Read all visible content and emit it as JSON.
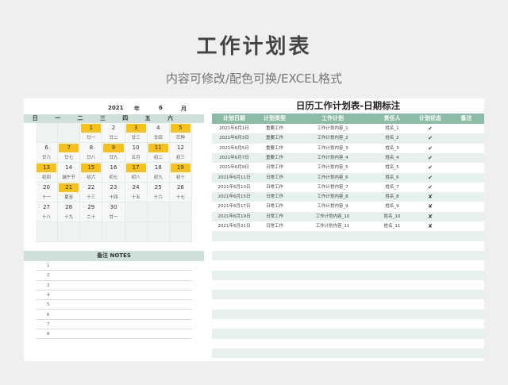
{
  "page": {
    "title": "工作计划表",
    "subtitle": "内容可修改/配色可换/EXCEL格式"
  },
  "calendar": {
    "year": "2021",
    "year_label": "年",
    "month": "6",
    "month_label": "月",
    "weekdays": [
      "日",
      "一",
      "二",
      "三",
      "四",
      "五",
      "六"
    ],
    "highlight_color": "#f7c11c",
    "cells": [
      {
        "day": "",
        "lunar": "",
        "hl": false
      },
      {
        "day": "",
        "lunar": "",
        "hl": false
      },
      {
        "day": "1",
        "lunar": "廿一",
        "hl": true
      },
      {
        "day": "2",
        "lunar": "廿二",
        "hl": false
      },
      {
        "day": "3",
        "lunar": "廿三",
        "hl": true
      },
      {
        "day": "4",
        "lunar": "廿四",
        "hl": false
      },
      {
        "day": "5",
        "lunar": "芒种",
        "hl": true
      },
      {
        "day": "6",
        "lunar": "廿六",
        "hl": false
      },
      {
        "day": "7",
        "lunar": "廿七",
        "hl": true
      },
      {
        "day": "8",
        "lunar": "廿八",
        "hl": false
      },
      {
        "day": "9",
        "lunar": "廿九",
        "hl": true
      },
      {
        "day": "10",
        "lunar": "五月",
        "hl": false
      },
      {
        "day": "11",
        "lunar": "初二",
        "hl": true
      },
      {
        "day": "12",
        "lunar": "初三",
        "hl": false
      },
      {
        "day": "13",
        "lunar": "初四",
        "hl": true
      },
      {
        "day": "14",
        "lunar": "端午节",
        "hl": false
      },
      {
        "day": "15",
        "lunar": "初六",
        "hl": true
      },
      {
        "day": "16",
        "lunar": "初七",
        "hl": false
      },
      {
        "day": "17",
        "lunar": "初八",
        "hl": true
      },
      {
        "day": "18",
        "lunar": "初九",
        "hl": false
      },
      {
        "day": "19",
        "lunar": "初十",
        "hl": true
      },
      {
        "day": "20",
        "lunar": "十一",
        "hl": false
      },
      {
        "day": "21",
        "lunar": "夏至",
        "hl": true
      },
      {
        "day": "22",
        "lunar": "十三",
        "hl": false
      },
      {
        "day": "23",
        "lunar": "十四",
        "hl": false
      },
      {
        "day": "24",
        "lunar": "十五",
        "hl": false
      },
      {
        "day": "25",
        "lunar": "十六",
        "hl": false
      },
      {
        "day": "26",
        "lunar": "十七",
        "hl": false
      },
      {
        "day": "27",
        "lunar": "十八",
        "hl": false
      },
      {
        "day": "28",
        "lunar": "十九",
        "hl": false
      },
      {
        "day": "29",
        "lunar": "二十",
        "hl": false
      },
      {
        "day": "30",
        "lunar": "廿一",
        "hl": false
      },
      {
        "day": "",
        "lunar": "",
        "hl": false
      },
      {
        "day": "",
        "lunar": "",
        "hl": false
      },
      {
        "day": "",
        "lunar": "",
        "hl": false
      },
      {
        "day": "",
        "lunar": "",
        "hl": false
      },
      {
        "day": "",
        "lunar": "",
        "hl": false
      },
      {
        "day": "",
        "lunar": "",
        "hl": false
      },
      {
        "day": "",
        "lunar": "",
        "hl": false
      },
      {
        "day": "",
        "lunar": "",
        "hl": false
      },
      {
        "day": "",
        "lunar": "",
        "hl": false
      },
      {
        "day": "",
        "lunar": "",
        "hl": false
      }
    ]
  },
  "notes": {
    "title": "备注 NOTES",
    "rows": [
      "1",
      "2",
      "3",
      "4",
      "5",
      "6",
      "7",
      "8"
    ]
  },
  "table": {
    "title": "日历工作计划表-日期标注",
    "header_color": "#8bbca6",
    "columns": [
      "计划日期",
      "计划类型",
      "工作计划",
      "责任人",
      "计划状态",
      "备注"
    ],
    "rows": [
      [
        "2021年6月1日",
        "重要工作",
        "工作计划内容_1",
        "姓名_1",
        "✔",
        ""
      ],
      [
        "2021年6月3日",
        "重要工作",
        "工作计划内容_2",
        "姓名_2",
        "✔",
        ""
      ],
      [
        "2021年6月5日",
        "重要工作",
        "工作计划内容_3",
        "姓名_3",
        "✔",
        ""
      ],
      [
        "2021年6月7日",
        "重要工作",
        "工作计划内容_4",
        "姓名_4",
        "✔",
        ""
      ],
      [
        "2021年6月9日",
        "日常工作",
        "工作计划内容_5",
        "姓名_5",
        "✔",
        ""
      ],
      [
        "2021年6月11日",
        "日常工作",
        "工作计划内容_6",
        "姓名_6",
        "✔",
        ""
      ],
      [
        "2021年6月13日",
        "日常工作",
        "工作计划内容_7",
        "姓名_7",
        "✔",
        ""
      ],
      [
        "2021年6月15日",
        "日常工作",
        "工作计划内容_8",
        "姓名_8",
        "✘",
        ""
      ],
      [
        "2021年6月17日",
        "日常工作",
        "工作计划内容_9",
        "姓名_9",
        "✘",
        ""
      ],
      [
        "2021年6月19日",
        "日常工作",
        "工作计划内容_10",
        "姓名_10",
        "✘",
        ""
      ],
      [
        "2021年6月21日",
        "日常工作",
        "工作计划内容_11",
        "姓名_11",
        "✘",
        ""
      ]
    ]
  }
}
